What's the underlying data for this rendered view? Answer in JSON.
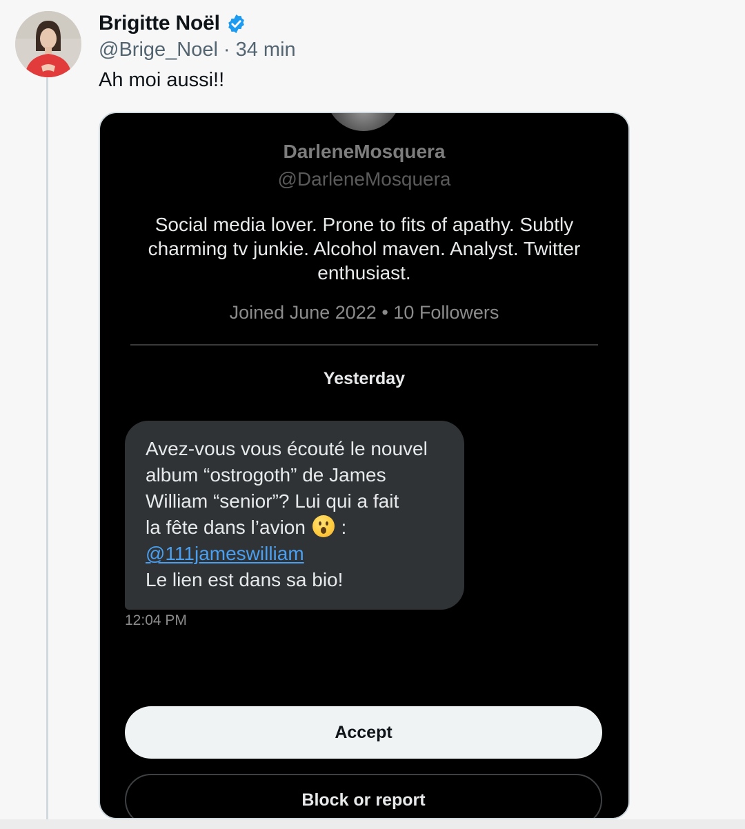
{
  "tweet": {
    "display_name": "Brigitte Noël",
    "handle": "@Brige_Noel",
    "separator": "·",
    "time_ago": "34 min",
    "text": "Ah moi aussi!!",
    "verified_icon": "verified-badge-icon",
    "accent_color": "#1d9bf0"
  },
  "dm_screenshot": {
    "profile_name": "DarleneMosquera",
    "profile_handle": "@DarleneMosquera",
    "bio": "Social media lover. Prone to fits of apathy. Subtly charming tv junkie. Alcohol maven. Analyst. Twitter enthusiast.",
    "joined": "Joined June 2022",
    "dot": "•",
    "followers": "10 Followers",
    "date_label": "Yesterday",
    "message": {
      "line1": "Avez-vous vous écouté le nouvel",
      "line2": "album “ostrogoth” de James",
      "line3": "William “senior”? Lui qui a fait",
      "line4_before_emoji": "la fête dans l’avion",
      "line4_after_emoji": ":",
      "emoji": "hushed-face-emoji",
      "mention": "@111jameswilliam",
      "line6": "Le lien est dans sa bio!"
    },
    "message_time": "12:04 PM",
    "accept_label": "Accept",
    "block_label": "Block or report",
    "link_color": "#4a9ff0"
  }
}
